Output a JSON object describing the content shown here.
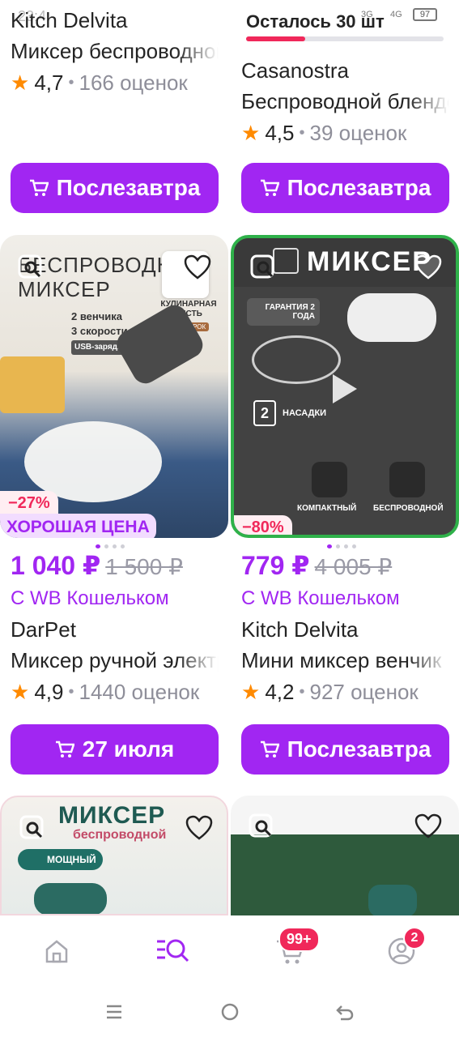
{
  "status_bar": {
    "time": "23:4",
    "battery": "97",
    "network": "4G",
    "signal": "3G"
  },
  "top_left_card": {
    "brand": "Kitch Delvita",
    "name": "Миксер беспроводной",
    "rating": "4,7",
    "reviews": "166 оценок",
    "buy_label": "Послезавтра"
  },
  "top_right_card": {
    "stock_text": "Осталось 30 шт",
    "brand": "Casanostra",
    "name": "Беспроводной блендер",
    "rating": "4,5",
    "reviews": "39 оценок",
    "buy_label": "Послезавтра"
  },
  "card3": {
    "image_title": "БЕСПРОВОДНОЙ МИКСЕР",
    "image_features": [
      "2 венчика",
      "3 скорости",
      "USB-зарядка"
    ],
    "image_gift_title": "КУЛИНАРНАЯ КИСТЬ",
    "image_gift_sub": "В ПОДАРОК",
    "discount": "−27%",
    "good_price": "ХОРОШАЯ ЦЕНА",
    "price": "1 040 ₽",
    "old_price": "1 500 ₽",
    "wallet": "С WB Кошельком",
    "brand": "DarPet",
    "name": "Миксер ручной электрический",
    "rating": "4,9",
    "reviews": "1440 оценок",
    "buy_label": "27 июля"
  },
  "card4": {
    "image_title": "МИКСЕР",
    "image_guarantee": "ГАРАНТИЯ 2 ГОДА",
    "image_attachments_count": "2",
    "image_attachments": "НАСАДКИ",
    "image_feature1": "КОМПАКТНЫЙ",
    "image_feature2": "БЕСПРОВОДНОЙ",
    "discount": "−80%",
    "price": "779 ₽",
    "old_price": "4 005 ₽",
    "wallet": "С WB Кошельком",
    "brand": "Kitch Delvita",
    "name": "Мини миксер венчик",
    "rating": "4,2",
    "reviews": "927 оценок",
    "buy_label": "Послезавтра"
  },
  "card5": {
    "image_title": "МИКСЕР",
    "image_sub": "беспроводной",
    "image_badge": "МОЩНЫЙ"
  },
  "card6": {},
  "bottom_nav": {
    "cart_badge": "99+",
    "profile_badge": "2"
  },
  "colors": {
    "accent": "#a126f2",
    "discount": "#f0285a",
    "star": "#ff8a00"
  }
}
